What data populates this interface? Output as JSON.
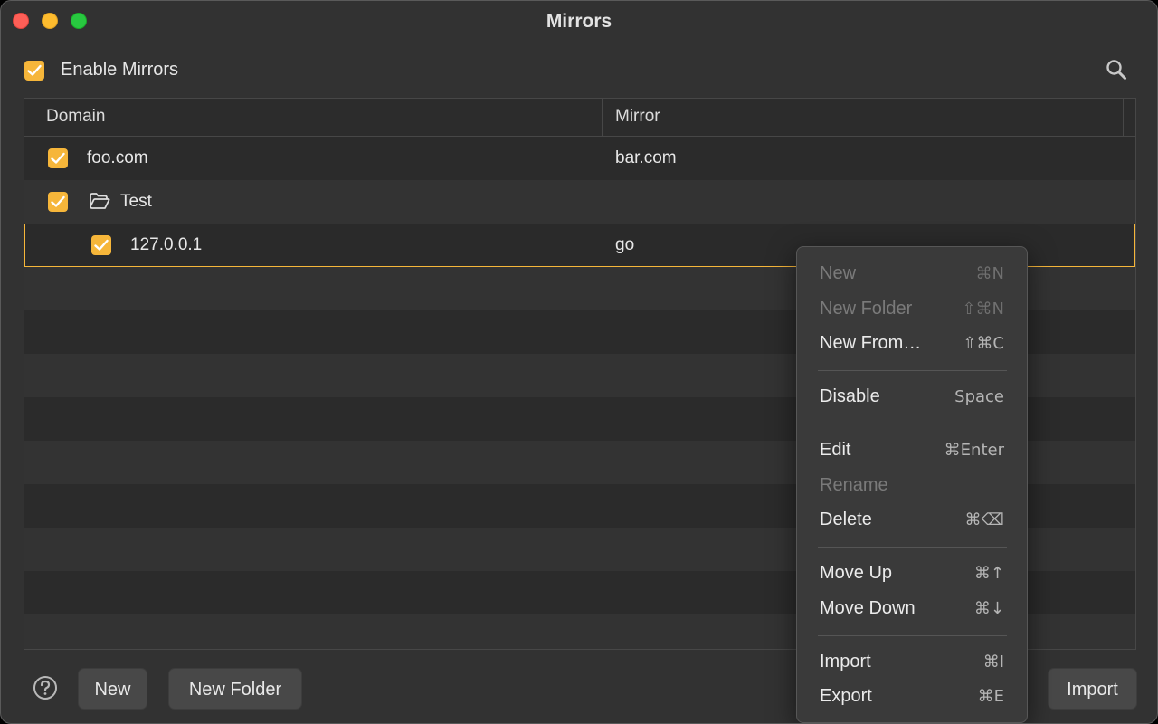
{
  "window": {
    "title": "Mirrors"
  },
  "toolbar": {
    "enable_label": "Enable Mirrors",
    "enable_checked": true
  },
  "table": {
    "columns": [
      "Domain",
      "Mirror"
    ],
    "rows": [
      {
        "domain": "foo.com",
        "mirror": "bar.com",
        "checked": true
      },
      {
        "domain": "Test",
        "mirror": "",
        "checked": true,
        "is_folder": true
      },
      {
        "domain": "127.0.0.1",
        "mirror": "go",
        "checked": true,
        "selected": true
      }
    ]
  },
  "bottom": {
    "new_label": "New",
    "new_folder_label": "New Folder",
    "import_label": "Import"
  },
  "context_menu": {
    "items": [
      {
        "label": "New",
        "shortcut": "⌘N"
      },
      {
        "label": "New Folder",
        "shortcut": "⇧⌘N"
      },
      {
        "label": "New From…",
        "shortcut": "⇧⌘C"
      },
      {
        "label": "Disable",
        "shortcut": "Space"
      },
      {
        "label": "Edit",
        "shortcut": "⌘Enter"
      },
      {
        "label": "Rename",
        "shortcut": ""
      },
      {
        "label": "Delete",
        "shortcut": "⌘⌫"
      },
      {
        "label": "Move Up",
        "shortcut": "⌘↑"
      },
      {
        "label": "Move Down",
        "shortcut": "⌘↓"
      },
      {
        "label": "Import",
        "shortcut": "⌘I"
      },
      {
        "label": "Export",
        "shortcut": "⌘E"
      }
    ]
  },
  "colors": {
    "accent": "#f6b63a",
    "background": "#323232",
    "table_bg": "#2b2b2b"
  }
}
